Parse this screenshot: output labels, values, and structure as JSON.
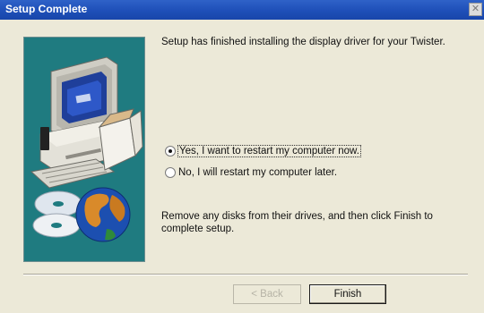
{
  "window": {
    "title": "Setup Complete",
    "close_symbol": "✕"
  },
  "message": "Setup has finished installing the display driver for your Twister.",
  "options": {
    "restart_now": "Yes, I want to restart my computer now.",
    "restart_later": "No, I will restart my computer later.",
    "selected": "restart_now"
  },
  "instructions": "Remove any disks from their drives, and then click Finish to complete setup.",
  "buttons": {
    "back": "< Back",
    "finish": "Finish"
  },
  "colors": {
    "banner_background": "#1f7b80",
    "titlebar": "#1e4fb8"
  },
  "icons": [
    "computer-icon",
    "globe-icon",
    "cd-disc-icon"
  ]
}
